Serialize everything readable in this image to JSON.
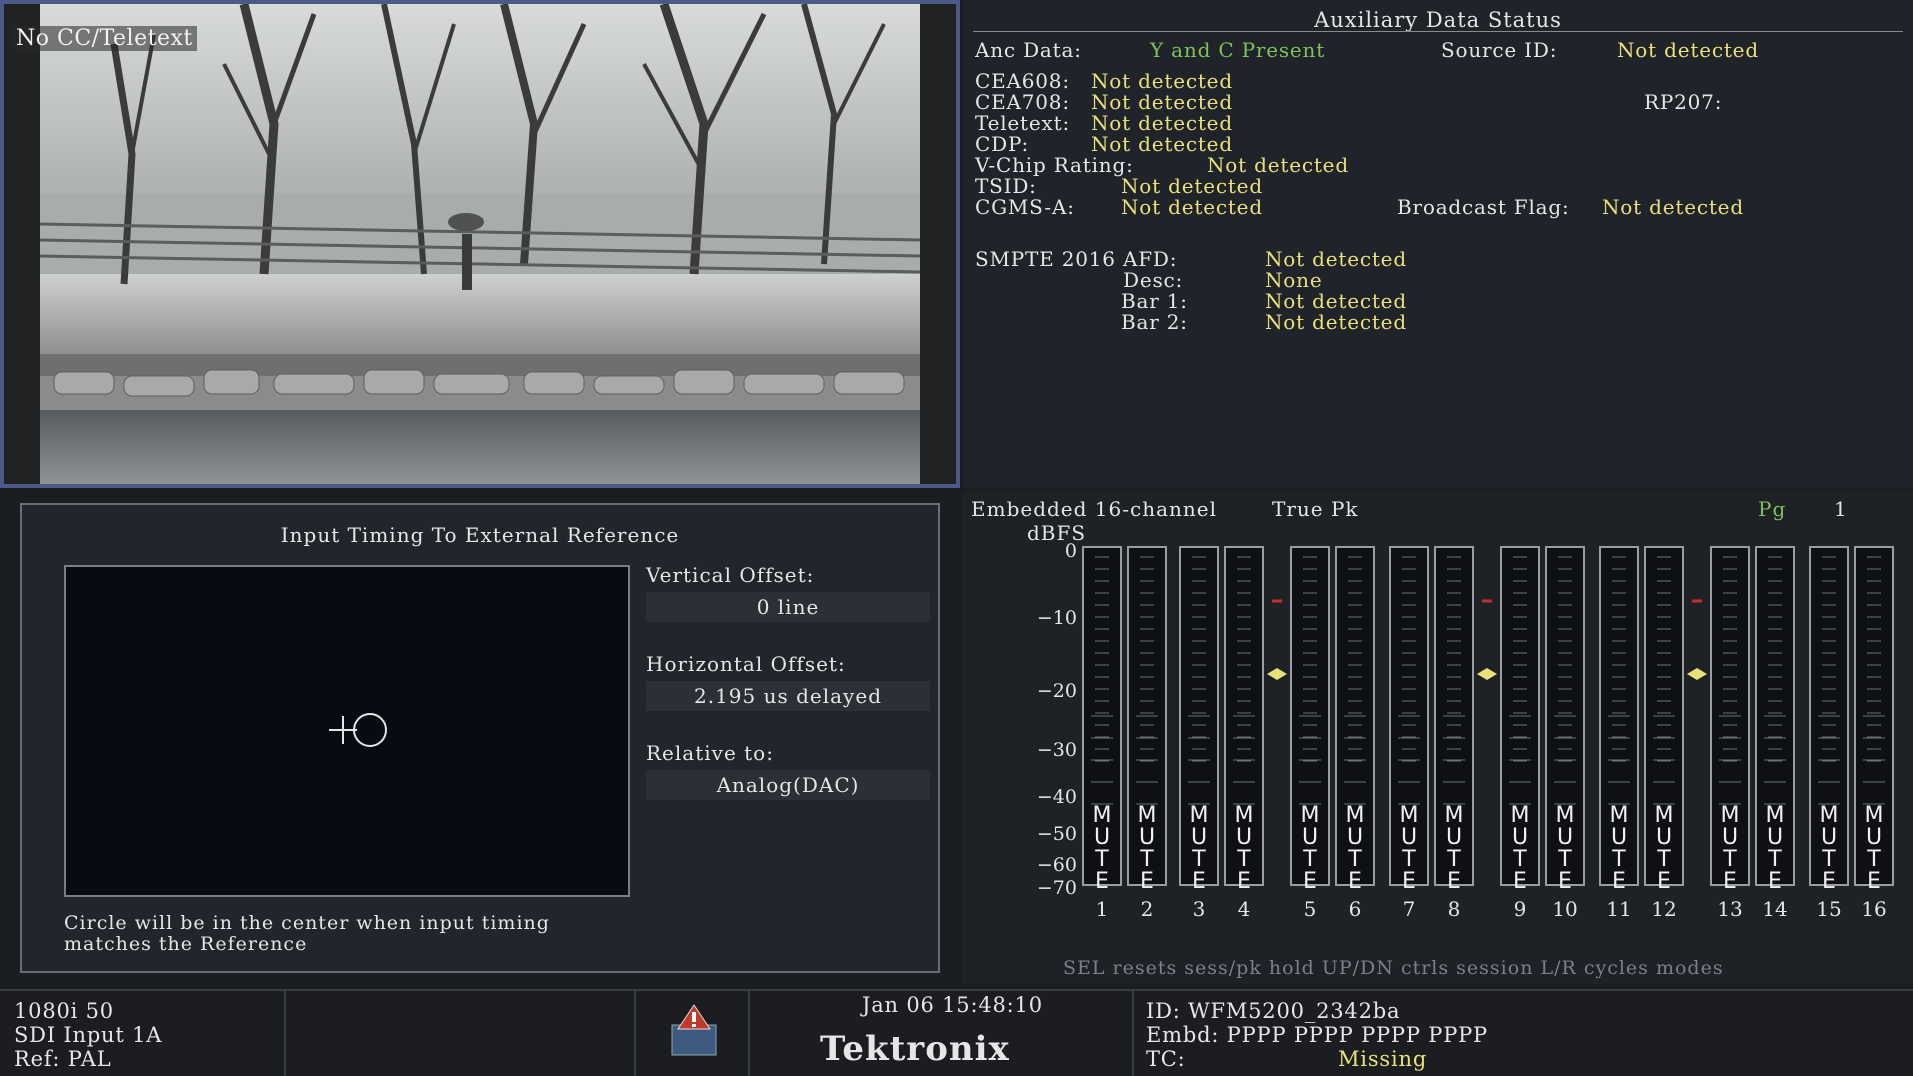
{
  "video": {
    "cc_label": "No CC/Teletext"
  },
  "aux": {
    "title": "Auxiliary Data Status",
    "anc_label": "Anc Data:",
    "anc_value": "Y and C Present",
    "source_label": "Source ID:",
    "source_value": "Not detected",
    "cea608_label": "CEA608:",
    "cea608_value": "Not detected",
    "cea708_label": "CEA708:",
    "cea708_value": "Not detected",
    "rp207_label": "RP207:",
    "teletext_label": "Teletext:",
    "teletext_value": "Not detected",
    "cdp_label": "CDP:",
    "cdp_value": "Not detected",
    "vchip_label": "V-Chip Rating:",
    "vchip_value": "Not detected",
    "tsid_label": "TSID:",
    "tsid_value": "Not detected",
    "cgms_label": "CGMS-A:",
    "cgms_value": "Not detected",
    "bflag_label": "Broadcast Flag:",
    "bflag_value": "Not detected",
    "afd_label": "SMPTE 2016 AFD:",
    "afd_value": "Not detected",
    "desc_label": "Desc:",
    "desc_value": "None",
    "bar1_label": "Bar 1:",
    "bar1_value": "Not detected",
    "bar2_label": "Bar 2:",
    "bar2_value": "Not detected"
  },
  "timing": {
    "title": "Input Timing To External Reference",
    "vertical_label": "Vertical Offset:",
    "vertical_value": "0 line",
    "horizontal_label": "Horizontal Offset:",
    "horizontal_value": "2.195 us delayed",
    "relative_label": "Relative to:",
    "relative_value": "Analog(DAC)",
    "note": "Circle will be in the center when input timing matches the Reference"
  },
  "audio": {
    "title": "Embedded 16-channel",
    "mode": "True Pk",
    "page_label": "Pg",
    "page_value": "1",
    "unit": "dBFS",
    "scale": [
      "0",
      "−10",
      "−20",
      "−30",
      "−40",
      "−50",
      "−60",
      "−70"
    ],
    "channels": [
      "1",
      "2",
      "3",
      "4",
      "5",
      "6",
      "7",
      "8",
      "9",
      "10",
      "11",
      "12",
      "13",
      "14",
      "15",
      "16"
    ],
    "mute_text": "MUTE",
    "footer": "SEL resets sess/pk hold  UP/DN ctrls session L/R cycles modes",
    "colors": {
      "reference_marker": "#e8e27a",
      "peak_marker": "#c03030"
    }
  },
  "status": {
    "format": "1080i 50",
    "input": "SDI Input 1A",
    "reference": "Ref: PAL",
    "datetime": "Jan 06 15:48:10",
    "brand": "Tektronix",
    "id": "ID: WFM5200_2342ba",
    "embd": "Embd: PPPP PPPP PPPP PPPP",
    "tc_label": "TC:",
    "tc_value": "Missing",
    "alarm_icon": "alarm-warning-icon"
  }
}
